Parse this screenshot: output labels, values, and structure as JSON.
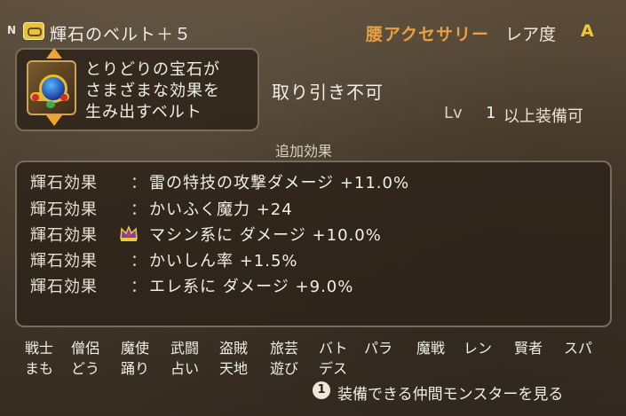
{
  "header": {
    "n_mark": "N",
    "item_name": "輝石のベルト＋５",
    "category": "腰アクセサリー",
    "rarity_label": "レア度",
    "rarity_value": "A"
  },
  "description": {
    "lines": [
      "とりどりの宝石が",
      "さまざまな効果を",
      "生み出すベルト"
    ]
  },
  "info": {
    "trade": "取り引き不可",
    "level_label": "Lv",
    "level_value": "1",
    "level_suffix": "以上装備可"
  },
  "effects": {
    "section_label": "追加効果",
    "rows": [
      {
        "label": "輝石効果",
        "sep": "：",
        "value": "雷の特技の攻撃ダメージ +11.0%"
      },
      {
        "label": "輝石効果",
        "sep": "：",
        "value": "かいふく魔力 +24"
      },
      {
        "label": "輝石効果",
        "sep": "：",
        "value": "マシン系に ダメージ +10.0%"
      },
      {
        "label": "輝石効果",
        "sep": "：",
        "value": "かいしん率 +1.5%"
      },
      {
        "label": "輝石効果",
        "sep": "：",
        "value": "エレ系に ダメージ +9.0%"
      }
    ]
  },
  "jobs": {
    "row1": [
      "戦士",
      "僧侶",
      "魔使",
      "武闘",
      "盗賊",
      "旅芸",
      "バト",
      "パラ",
      "魔戦",
      "レン",
      "賢者",
      "スパ"
    ],
    "row2": [
      "まも",
      "どう",
      "踊り",
      "占い",
      "天地",
      "遊び",
      "デス"
    ]
  },
  "hint": {
    "button": "1",
    "text": "装備できる仲間モンスターを見る"
  },
  "icons": {
    "item_small": "belt-icon",
    "item": "gem-belt-icon",
    "crown": "crown-icon"
  },
  "colors": {
    "category": "#e9a043",
    "rarity": "#f0c63a",
    "arrow": "#f0a62e"
  }
}
